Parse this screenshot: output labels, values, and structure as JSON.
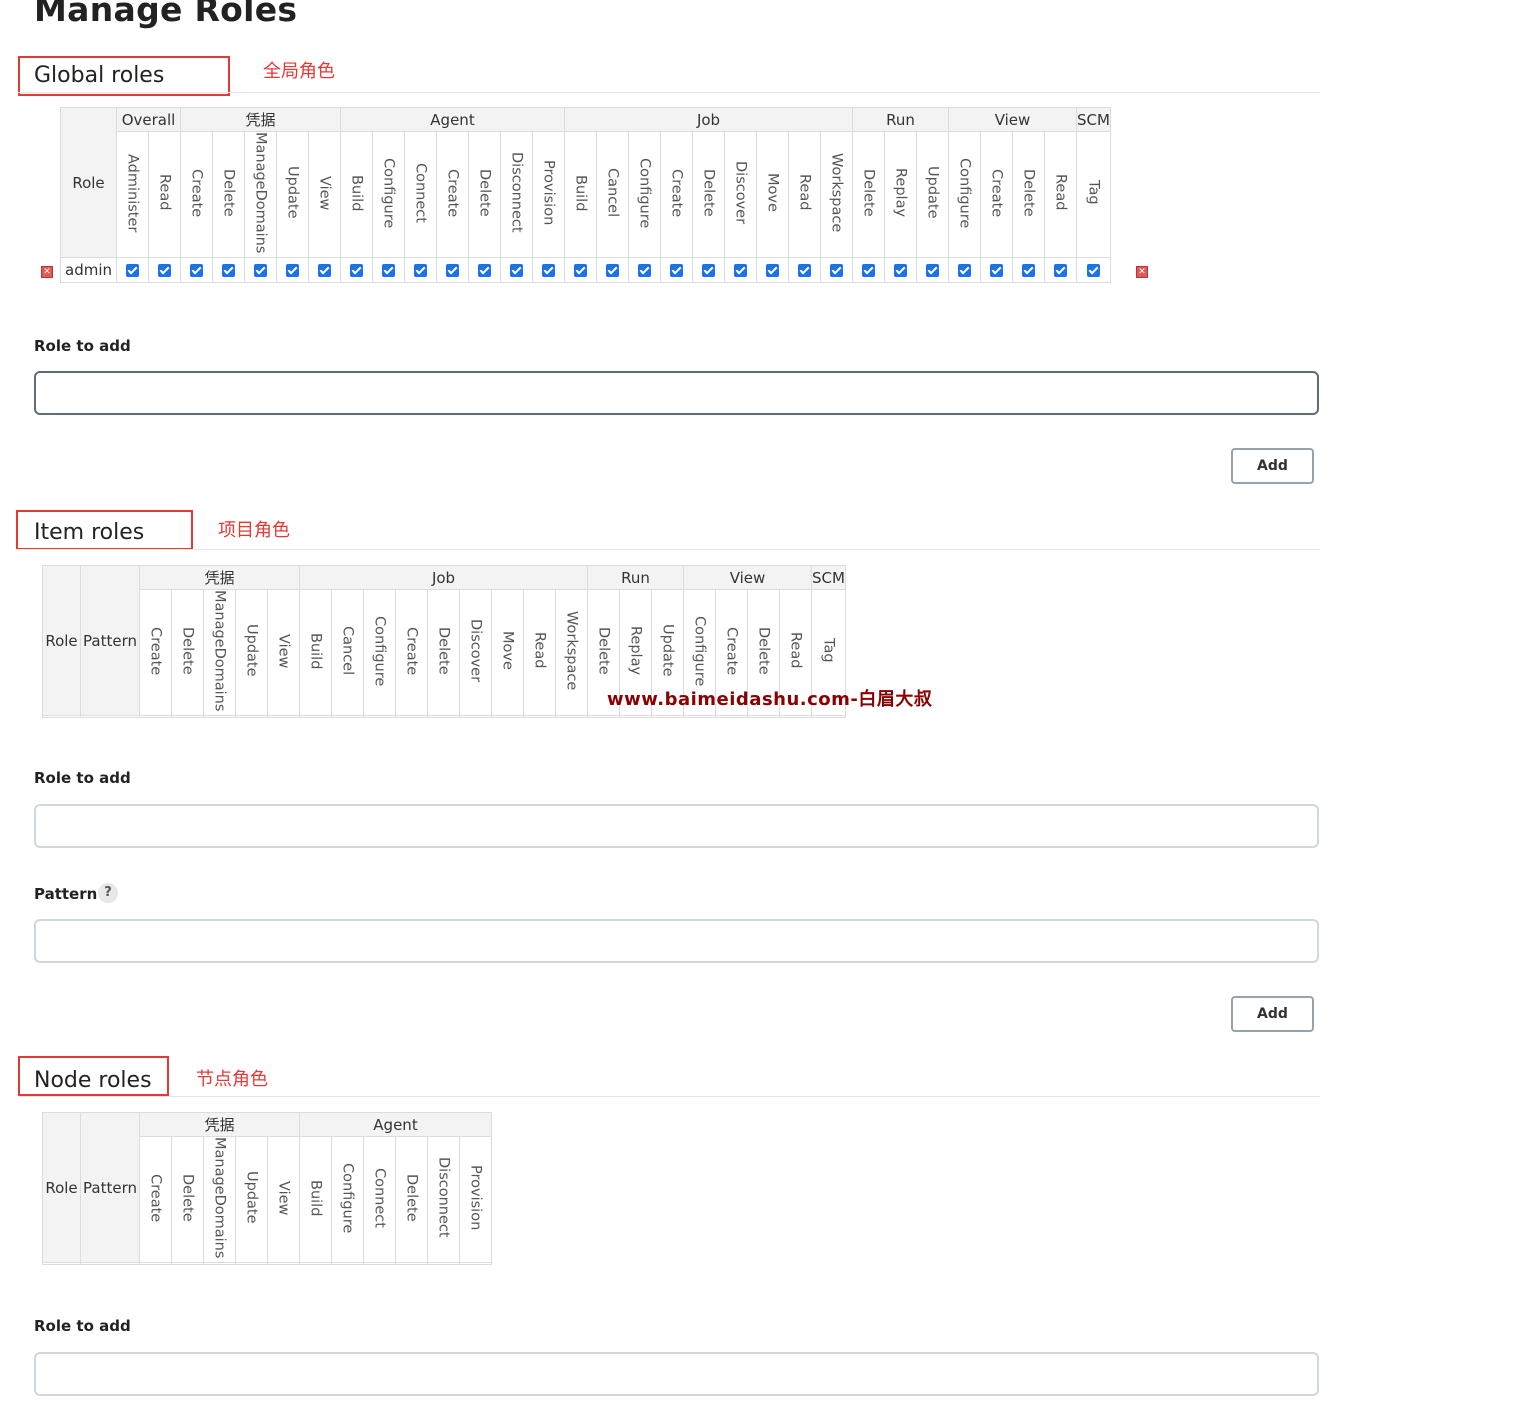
{
  "page_title": "Manage Roles",
  "colors": {
    "accent": "#1a73e8",
    "annotation": "#e53935",
    "watermark": "#8b0000"
  },
  "global": {
    "title": "Global roles",
    "annotation": "全局角色",
    "role_header": "Role",
    "groups": [
      {
        "label": "Overall",
        "perms": [
          "Administer",
          "Read"
        ]
      },
      {
        "label": "凭据",
        "perms": [
          "Create",
          "Delete",
          "ManageDomains",
          "Update",
          "View"
        ]
      },
      {
        "label": "Agent",
        "perms": [
          "Build",
          "Configure",
          "Connect",
          "Create",
          "Delete",
          "Disconnect",
          "Provision"
        ]
      },
      {
        "label": "Job",
        "perms": [
          "Build",
          "Cancel",
          "Configure",
          "Create",
          "Delete",
          "Discover",
          "Move",
          "Read",
          "Workspace"
        ]
      },
      {
        "label": "Run",
        "perms": [
          "Delete",
          "Replay",
          "Update"
        ]
      },
      {
        "label": "View",
        "perms": [
          "Configure",
          "Create",
          "Delete",
          "Read"
        ]
      },
      {
        "label": "SCM",
        "perms": [
          "Tag"
        ]
      }
    ],
    "rows": [
      {
        "name": "admin",
        "checked": true
      }
    ],
    "role_to_add_label": "Role to add",
    "role_to_add_value": "",
    "add_label": "Add"
  },
  "item": {
    "title": "Item roles",
    "annotation": "项目角色",
    "role_header": "Role",
    "pattern_header": "Pattern",
    "groups": [
      {
        "label": "凭据",
        "perms": [
          "Create",
          "Delete",
          "ManageDomains",
          "Update",
          "View"
        ]
      },
      {
        "label": "Job",
        "perms": [
          "Build",
          "Cancel",
          "Configure",
          "Create",
          "Delete",
          "Discover",
          "Move",
          "Read",
          "Workspace"
        ]
      },
      {
        "label": "Run",
        "perms": [
          "Delete",
          "Replay",
          "Update"
        ]
      },
      {
        "label": "View",
        "perms": [
          "Configure",
          "Create",
          "Delete",
          "Read"
        ]
      },
      {
        "label": "SCM",
        "perms": [
          "Tag"
        ]
      }
    ],
    "role_to_add_label": "Role to add",
    "role_to_add_value": "",
    "pattern_label": "Pattern",
    "pattern_help": "?",
    "pattern_value": "",
    "add_label": "Add"
  },
  "node": {
    "title": "Node roles",
    "annotation": "节点角色",
    "role_header": "Role",
    "pattern_header": "Pattern",
    "groups": [
      {
        "label": "凭据",
        "perms": [
          "Create",
          "Delete",
          "ManageDomains",
          "Update",
          "View"
        ]
      },
      {
        "label": "Agent",
        "perms": [
          "Build",
          "Configure",
          "Connect",
          "Delete",
          "Disconnect",
          "Provision"
        ]
      }
    ],
    "role_to_add_label": "Role to add",
    "role_to_add_value": ""
  },
  "watermark": "www.baimeidashu.com-白眉大叔"
}
